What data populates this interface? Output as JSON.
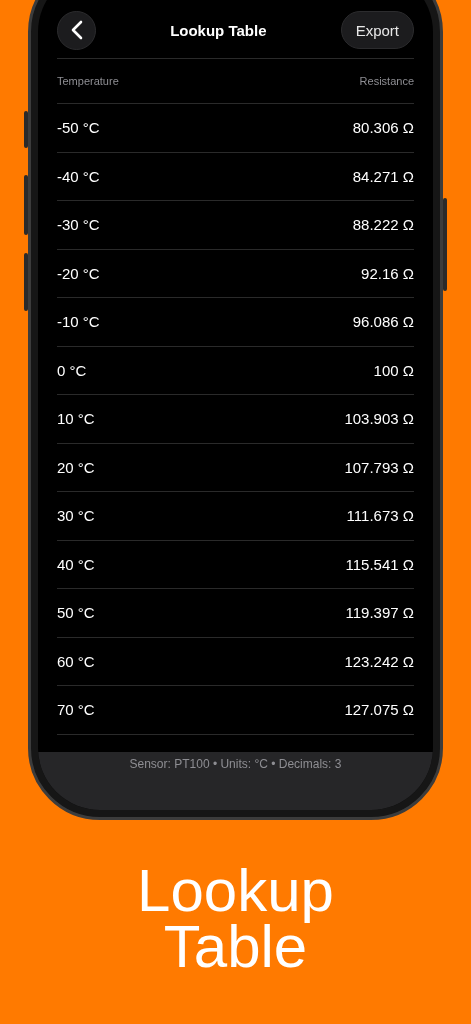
{
  "nav": {
    "title": "Lookup Table",
    "export_button": "Export"
  },
  "table": {
    "columns": [
      "Temperature",
      "Resistance"
    ],
    "rows": [
      [
        "-50 °C",
        "80.306 Ω"
      ],
      [
        "-40 °C",
        "84.271 Ω"
      ],
      [
        "-30 °C",
        "88.222 Ω"
      ],
      [
        "-20 °C",
        "92.16 Ω"
      ],
      [
        "-10 °C",
        "96.086 Ω"
      ],
      [
        "0 °C",
        "100 Ω"
      ],
      [
        "10 °C",
        "103.903 Ω"
      ],
      [
        "20 °C",
        "107.793 Ω"
      ],
      [
        "30 °C",
        "111.673 Ω"
      ],
      [
        "40 °C",
        "115.541 Ω"
      ],
      [
        "50 °C",
        "119.397 Ω"
      ],
      [
        "60 °C",
        "123.242 Ω"
      ],
      [
        "70 °C",
        "127.075 Ω"
      ]
    ]
  },
  "status_bar": "Sensor: PT100 • Units: °C • Decimals: 3",
  "headline": [
    "Lookup",
    "Table"
  ]
}
